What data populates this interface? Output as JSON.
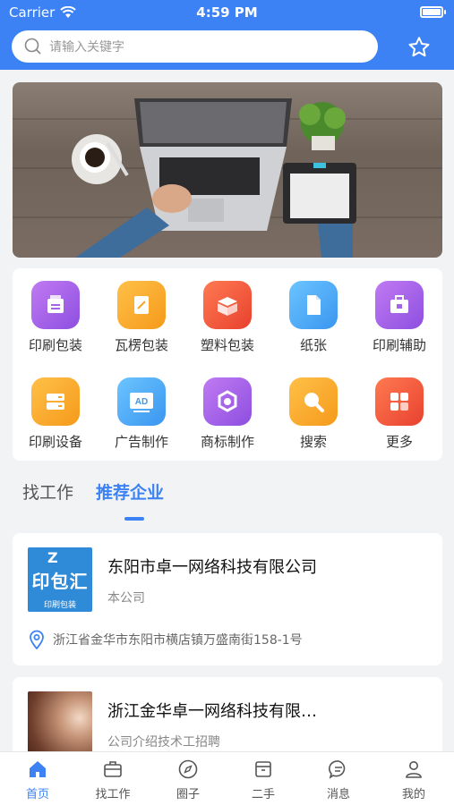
{
  "status": {
    "carrier": "Carrier",
    "time": "4:59 PM"
  },
  "search": {
    "placeholder": "请输入关键字"
  },
  "categories": [
    {
      "label": "印刷包装",
      "icon": "print-package-icon",
      "color": "#a464e8"
    },
    {
      "label": "瓦楞包装",
      "icon": "corrugated-package-icon",
      "color": "#f5a623"
    },
    {
      "label": "塑料包装",
      "icon": "plastic-package-icon",
      "color": "#f0573a"
    },
    {
      "label": "纸张",
      "icon": "paper-icon",
      "color": "#45a8f5"
    },
    {
      "label": "印刷辅助",
      "icon": "print-aid-icon",
      "color": "#a464e8"
    },
    {
      "label": "印刷设备",
      "icon": "print-equipment-icon",
      "color": "#f5a623"
    },
    {
      "label": "广告制作",
      "icon": "ad-production-icon",
      "color": "#45a8f5"
    },
    {
      "label": "商标制作",
      "icon": "trademark-icon",
      "color": "#a464e8"
    },
    {
      "label": "搜索",
      "icon": "search-icon",
      "color": "#f5a623"
    },
    {
      "label": "更多",
      "icon": "more-icon",
      "color": "#f0573a"
    }
  ],
  "tabs": {
    "job": "找工作",
    "recommend": "推荐企业"
  },
  "companies": [
    {
      "name": "东阳市卓一网络科技有限公司",
      "sub": "本公司",
      "address": "浙江省金华市东阳市横店镇万盛南街158-1号",
      "logo_text": "印包汇",
      "logo_sub": "印刷包装",
      "logo_mark": "Z"
    },
    {
      "name": "浙江金华卓一网络科技有限…",
      "sub": "公司介绍技术工招聘"
    }
  ],
  "bottom_nav": [
    {
      "label": "首页",
      "icon": "home-icon",
      "active": true
    },
    {
      "label": "找工作",
      "icon": "briefcase-icon",
      "active": false
    },
    {
      "label": "圈子",
      "icon": "compass-icon",
      "active": false
    },
    {
      "label": "二手",
      "icon": "box-icon",
      "active": false
    },
    {
      "label": "消息",
      "icon": "message-icon",
      "active": false
    },
    {
      "label": "我的",
      "icon": "user-icon",
      "active": false
    }
  ],
  "colors": {
    "primary": "#3d82f5",
    "background": "#f2f3f5"
  }
}
